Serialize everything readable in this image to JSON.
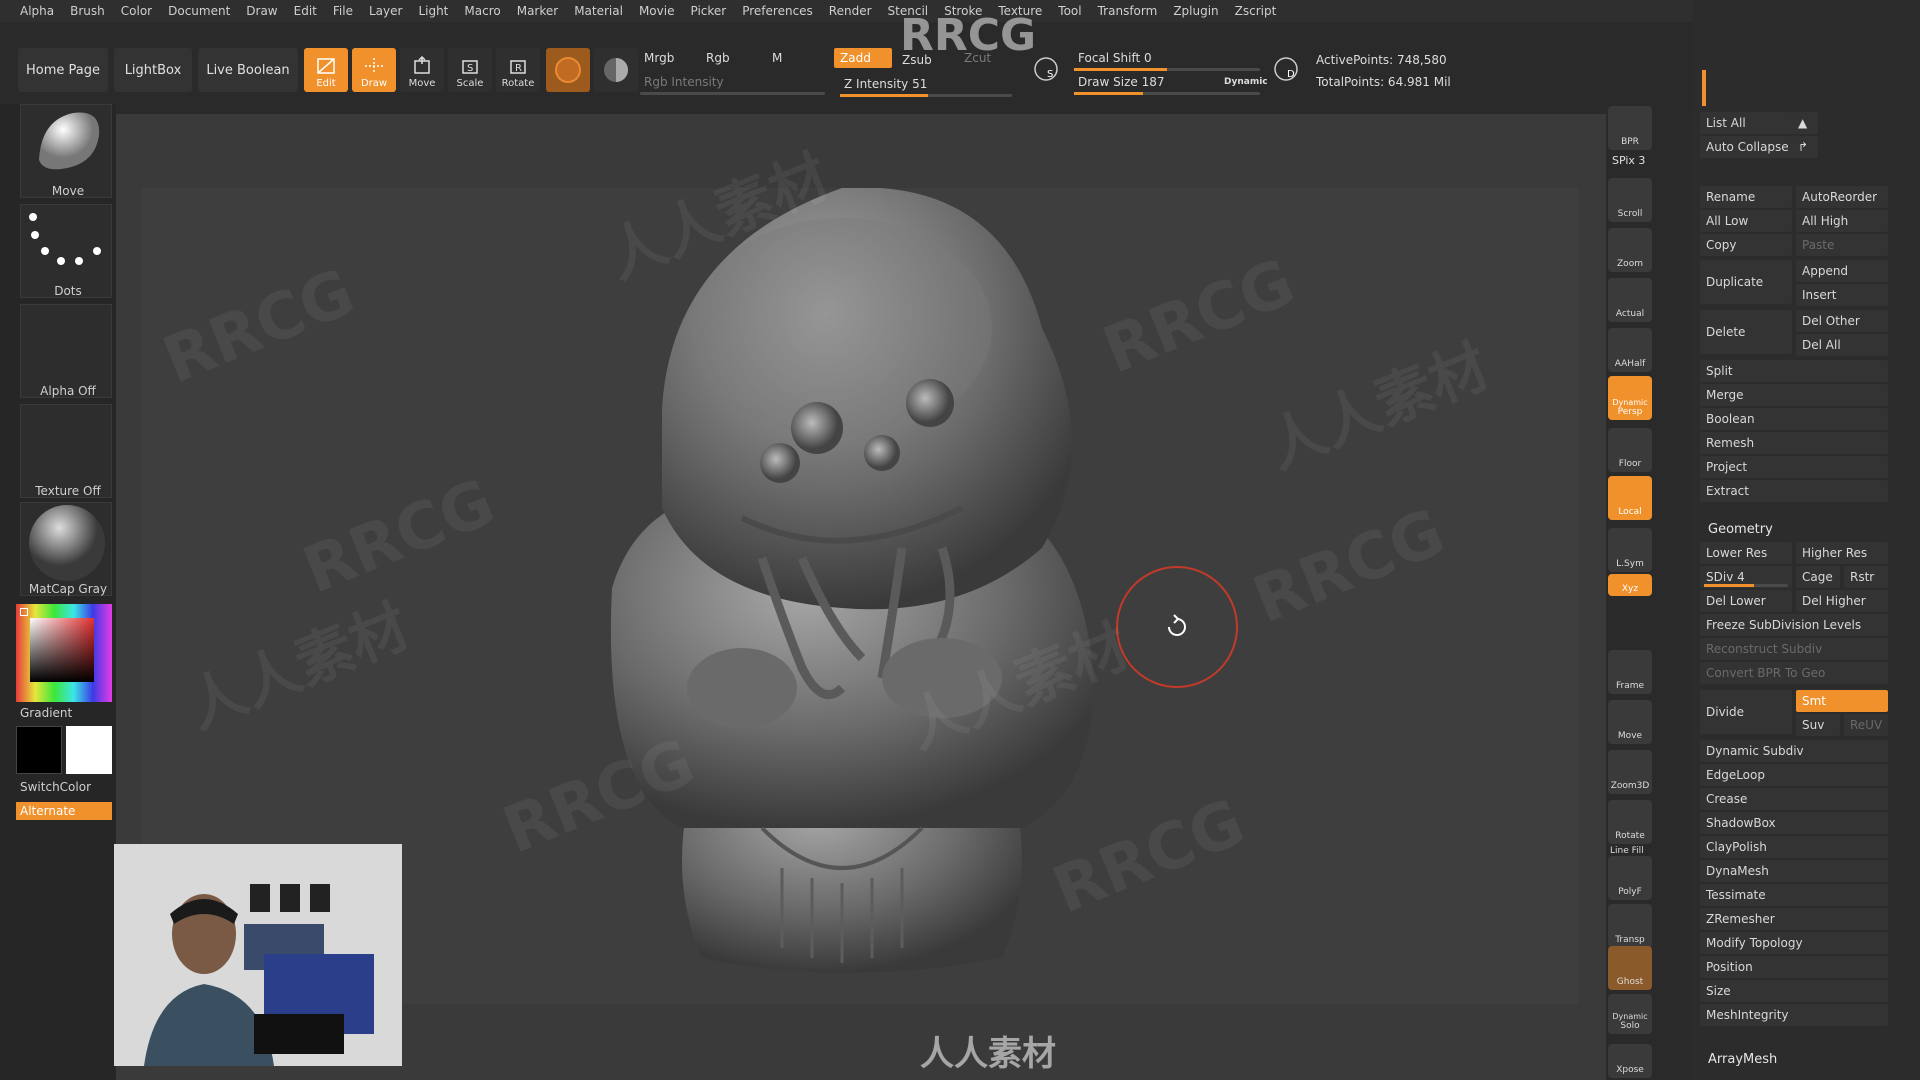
{
  "menu": [
    "Alpha",
    "Brush",
    "Color",
    "Document",
    "Draw",
    "Edit",
    "File",
    "Layer",
    "Light",
    "Macro",
    "Marker",
    "Material",
    "Movie",
    "Picker",
    "Preferences",
    "Render",
    "Stencil",
    "Stroke",
    "Texture",
    "Tool",
    "Transform",
    "Zplugin",
    "Zscript"
  ],
  "shelf": {
    "home_page": "Home Page",
    "lightbox": "LightBox",
    "live_boolean": "Live Boolean",
    "edit": "Edit",
    "draw": "Draw",
    "move": "Move",
    "scale": "Scale",
    "rotate": "Rotate",
    "mrgb": "Mrgb",
    "rgb": "Rgb",
    "m": "M",
    "rgb_intensity": "Rgb Intensity",
    "zadd": "Zadd",
    "zsub": "Zsub",
    "zcut": "Zcut",
    "z_intensity": "Z Intensity 51",
    "focal_shift": "Focal Shift 0",
    "draw_size": "Draw Size 187",
    "dynamic": "Dynamic",
    "active_points": "ActivePoints: 748,580",
    "total_points": "TotalPoints: 64.981 Mil",
    "z_intensity_level": 0.51,
    "focal_shift_level": 0.5,
    "draw_size_level": 0.37
  },
  "left": {
    "move": "Move",
    "dots": "Dots",
    "alpha_off": "Alpha Off",
    "texture_off": "Texture Off",
    "matcap": "MatCap Gray",
    "gradient": "Gradient",
    "switch_color": "SwitchColor",
    "alternate": "Alternate"
  },
  "watermark": {
    "top": "RRCG",
    "bottom": "人人素材",
    "repeat_a": "RRCG",
    "repeat_b": "人人素材"
  },
  "rightcol": {
    "bpr": "BPR",
    "spix": "SPix 3",
    "scroll": "Scroll",
    "zoom": "Zoom",
    "actual": "Actual",
    "aahalf": "AAHalf",
    "dynamic": "Dynamic",
    "persp": "Persp",
    "floor": "Floor",
    "local": "Local",
    "lsym": "L.Sym",
    "xyz": "Xyz",
    "frame": "Frame",
    "move": "Move",
    "zoom3d": "Zoom3D",
    "rotate": "Rotate",
    "line_fill": "Line Fill",
    "polyf": "PolyF",
    "transp": "Transp",
    "ghost": "Ghost",
    "dynamic2": "Dynamic",
    "solo": "Solo",
    "xpose": "Xpose"
  },
  "palette": {
    "list_all": "List All",
    "auto_collapse": "Auto Collapse",
    "rename": "Rename",
    "autoreorder": "AutoReorder",
    "all_low": "All Low",
    "all_high": "All High",
    "copy": "Copy",
    "paste": "Paste",
    "duplicate": "Duplicate",
    "append": "Append",
    "insert": "Insert",
    "delete": "Delete",
    "del_other": "Del Other",
    "del_all": "Del All",
    "split": "Split",
    "merge": "Merge",
    "boolean": "Boolean",
    "remesh": "Remesh",
    "project": "Project",
    "extract": "Extract",
    "geometry": "Geometry",
    "lower_res": "Lower Res",
    "higher_res": "Higher Res",
    "sdiv": "SDiv 4",
    "cage": "Cage",
    "rstr": "Rstr",
    "del_lower": "Del Lower",
    "del_higher": "Del Higher",
    "freeze": "Freeze SubDivision Levels",
    "reconstruct": "Reconstruct Subdiv",
    "convert_bpr": "Convert BPR To Geo",
    "divide": "Divide",
    "smt": "Smt",
    "suv": "Suv",
    "reuv": "ReUV",
    "dynamic_subdiv": "Dynamic Subdiv",
    "edgeloop": "EdgeLoop",
    "crease": "Crease",
    "shadowbox": "ShadowBox",
    "claypolish": "ClayPolish",
    "dynamesh": "DynaMesh",
    "tessimate": "Tessimate",
    "zremesher": "ZRemesher",
    "modify_topology": "Modify Topology",
    "position": "Position",
    "size": "Size",
    "meshintegrity": "MeshIntegrity",
    "arraymesh": "ArrayMesh",
    "sdiv_level": 0.6
  },
  "colors": {
    "accent": "#f0912c",
    "bg": "#2b2b2b",
    "panel": "#333333"
  }
}
